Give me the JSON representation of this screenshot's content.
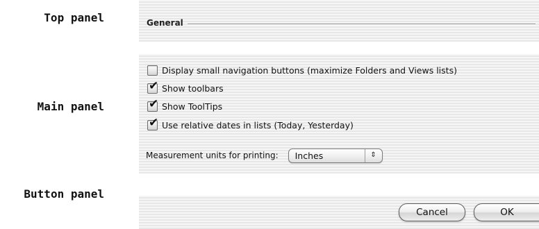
{
  "annotations": {
    "top_panel": "Top panel",
    "main_panel": "Main panel",
    "button_panel": "Button panel"
  },
  "top_panel": {
    "group_title": "General"
  },
  "main_panel": {
    "options": [
      {
        "label": "Display small navigation buttons (maximize Folders and Views lists)",
        "checked": false
      },
      {
        "label": "Show toolbars",
        "checked": true
      },
      {
        "label": "Show ToolTips",
        "checked": true
      },
      {
        "label": "Use relative dates in lists (Today, Yesterday)",
        "checked": true
      }
    ],
    "measurement": {
      "label": "Measurement units for printing:",
      "selected": "Inches",
      "arrow_glyph": "⇕"
    }
  },
  "button_panel": {
    "cancel_label": "Cancel",
    "ok_label": "OK"
  },
  "glyphs": {
    "check_mark": "✔"
  }
}
